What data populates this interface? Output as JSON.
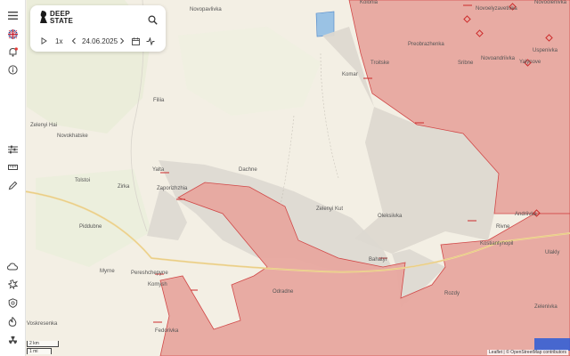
{
  "brand": {
    "line1": "DEEP",
    "line2": "STATE"
  },
  "timeline": {
    "speed": "1x",
    "date": "24.06.2025"
  },
  "places": {
    "novopavlivka": "Novopavlivka",
    "filiia": "Filiia",
    "zelenyi_hai": "Zelenyi Hai",
    "novokhatske": "Novokhatske",
    "tolstoi": "Tolstoi",
    "zirka": "Zirka",
    "yalta": "Yalta",
    "zaporizhzhia": "Zaporizhzhia",
    "dachne": "Dachne",
    "piddubne": "Piddubne",
    "myrne": "Myrne",
    "pereshchepyne": "Pereshchepyne",
    "komyshuvakha": "Komysh",
    "voskresenka": "Voskresenka",
    "fedorivka": "Fedorivka",
    "odradne": "Odradne",
    "zelenyi_kut": "Zelenyi Kut",
    "oleksiivka": "Oleksiivka",
    "bahatyr": "Bahatyr",
    "komar": "Komar",
    "troitske": "Troitske",
    "preobrazhenka": "Preobrazhenka",
    "novoelyzavetivka": "Novoelyzavetivka",
    "novoolenivka": "Novoolenivka",
    "novoandriivka": "Novoandriivka",
    "sribne": "Sribne",
    "yalynove": "Yalynove",
    "andriivka": "Andriivka",
    "rivne": "Rivne",
    "kostiantynopil": "Kostiantynopil",
    "ulakly": "Ulakly",
    "rozdy": "Rozdy",
    "zelenivka": "Zelenivka",
    "uspenivka": "Uspenivka",
    "kolonia": "Kolonia"
  },
  "scale": {
    "km": "2 km",
    "mi": "1 mi"
  },
  "attribution": "Leaflet | © OpenStreetMap contributors",
  "colors": {
    "occupied": "#e8a8a0",
    "contested": "#ddd8d0",
    "border_red": "#d04040",
    "base": "#f3efe4",
    "accent_blue": "#2a5bd7"
  },
  "icons": [
    "menu-icon",
    "flag-icon",
    "bell-icon",
    "info-icon",
    "sliders-icon",
    "ruler-icon",
    "pen-icon",
    "cloud-icon",
    "explosion-icon",
    "shield-icon",
    "fire-icon",
    "radiation-icon"
  ]
}
